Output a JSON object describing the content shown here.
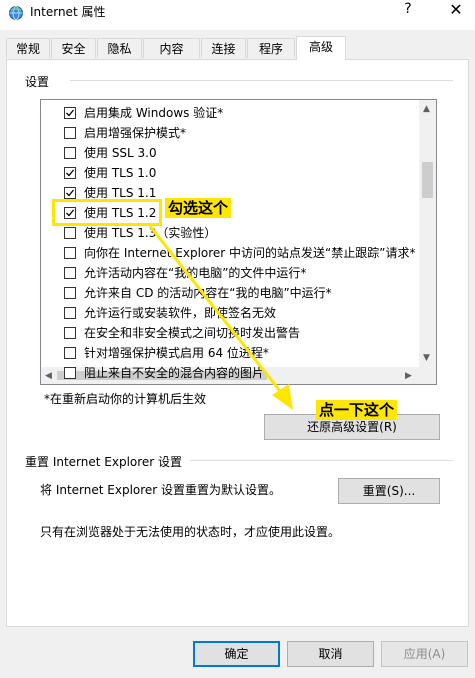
{
  "window": {
    "title": "Internet 属性",
    "help": "?",
    "close": "✕"
  },
  "tabs": [
    {
      "label": "常规"
    },
    {
      "label": "安全"
    },
    {
      "label": "隐私"
    },
    {
      "label": "内容"
    },
    {
      "label": "连接"
    },
    {
      "label": "程序"
    },
    {
      "label": "高级",
      "active": true
    }
  ],
  "settings": {
    "group_label": "设置",
    "items": [
      {
        "label": "启用集成 Windows 验证*",
        "checked": true
      },
      {
        "label": "启用增强保护模式*",
        "checked": false
      },
      {
        "label": "使用 SSL 3.0",
        "checked": false
      },
      {
        "label": "使用 TLS 1.0",
        "checked": true
      },
      {
        "label": "使用 TLS 1.1",
        "checked": true
      },
      {
        "label": "使用 TLS 1.2",
        "checked": true
      },
      {
        "label": "使用 TLS 1.3（实验性）",
        "checked": false
      },
      {
        "label": "向你在 Internet Explorer 中访问的站点发送“禁止跟踪”请求*",
        "checked": false
      },
      {
        "label": "允许活动内容在“我的电脑”的文件中运行*",
        "checked": false
      },
      {
        "label": "允许来自 CD 的活动内容在“我的电脑”中运行*",
        "checked": false
      },
      {
        "label": "允许运行或安装软件，即使签名无效",
        "checked": false
      },
      {
        "label": "在安全和非安全模式之间切换时发出警告",
        "checked": false
      },
      {
        "label": "针对增强保护模式启用 64 位进程*",
        "checked": false
      },
      {
        "label": "阻止来自不安全的混合内容的图片",
        "checked": false
      }
    ],
    "restart_note": "*在重新启动你的计算机后生效",
    "restore_button": "还原高级设置(R)"
  },
  "reset": {
    "group_label": "重置 Internet Explorer 设置",
    "text": "将 Internet Explorer 设置重置为默认设置。",
    "button": "重置(S)...",
    "note": "只有在浏览器处于无法使用的状态时，才应使用此设置。"
  },
  "footer": {
    "ok": "确定",
    "cancel": "取消",
    "apply": "应用(A)"
  },
  "annotations": {
    "check_this": "勾选这个",
    "click_this": "点一下这个",
    "highlight_color": "#ffe600"
  }
}
